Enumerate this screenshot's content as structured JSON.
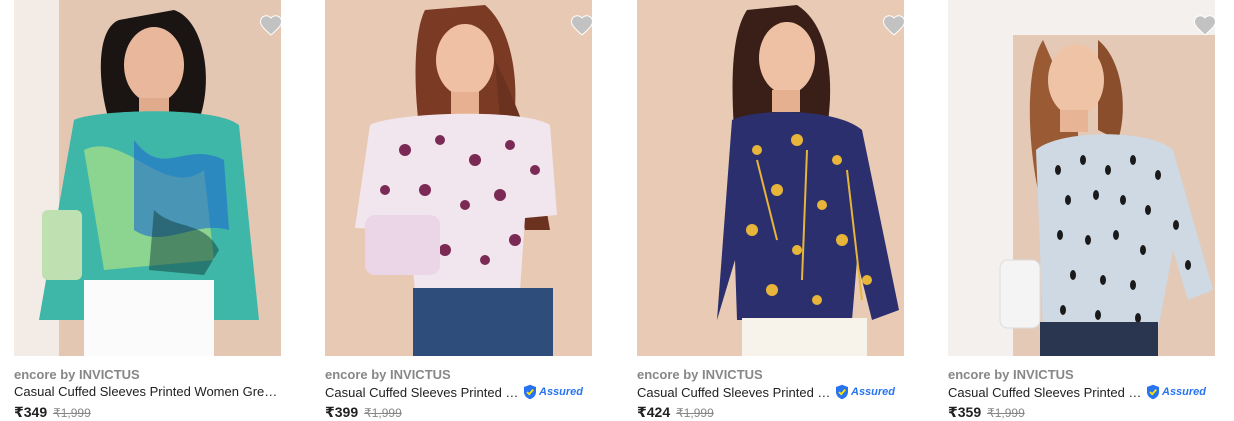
{
  "products": [
    {
      "brand": "encore by INVICTUS",
      "title": "Casual Cuffed Sleeves Printed Women Green...",
      "assured": false,
      "assured_label": "",
      "price": "₹349",
      "mrp": "₹1,999",
      "wishlist_icon": "heart-icon",
      "image_desc_colors": {
        "background": "#e4c7b2",
        "top": "#3fb7a8",
        "accent": "#9fdc8a"
      }
    },
    {
      "brand": "encore by INVICTUS",
      "title": "Casual Cuffed Sleeves Printed W...",
      "assured": true,
      "assured_label": "Assured",
      "price": "₹399",
      "mrp": "₹1,999",
      "wishlist_icon": "heart-icon",
      "image_desc_colors": {
        "background": "#e8c9b4",
        "top": "#f2e6ee",
        "accent": "#7a2a55"
      }
    },
    {
      "brand": "encore by INVICTUS",
      "title": "Casual Cuffed Sleeves Printed W...",
      "assured": true,
      "assured_label": "Assured",
      "price": "₹424",
      "mrp": "₹1,999",
      "wishlist_icon": "heart-icon",
      "image_desc_colors": {
        "background": "#e9cab4",
        "top": "#2c2f6e",
        "accent": "#e6b53a"
      }
    },
    {
      "brand": "encore by INVICTUS",
      "title": "Casual Cuffed Sleeves Printed W...",
      "assured": true,
      "assured_label": "Assured",
      "price": "₹359",
      "mrp": "₹1,999",
      "wishlist_icon": "heart-icon",
      "image_desc_colors": {
        "background": "#e3c9b6",
        "top": "#cfd9e4",
        "accent": "#1a1a1a"
      }
    }
  ],
  "colors": {
    "brand_text": "#878787",
    "title_text": "#212121",
    "assured_blue": "#2874f0",
    "heart_fill": "#c2c2c2"
  }
}
